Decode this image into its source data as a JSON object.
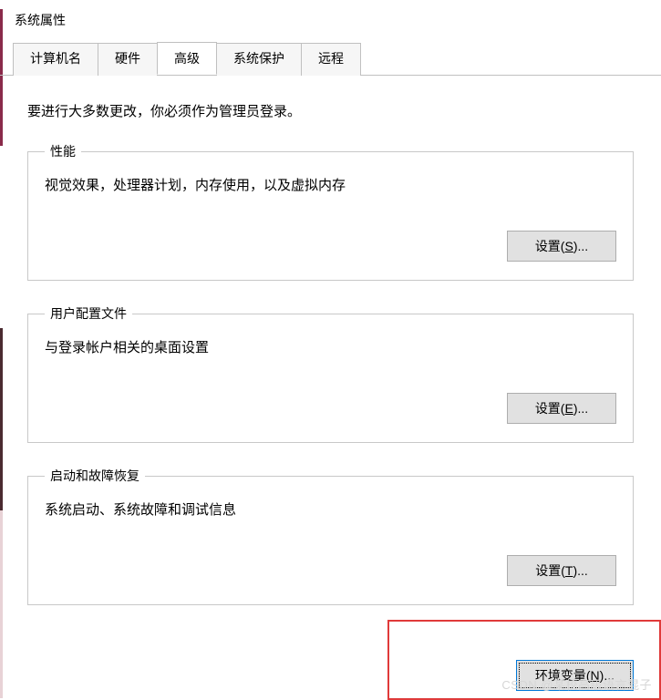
{
  "window": {
    "title": "系统属性"
  },
  "tabs": [
    {
      "label": "计算机名"
    },
    {
      "label": "硬件"
    },
    {
      "label": "高级"
    },
    {
      "label": "系统保护"
    },
    {
      "label": "远程"
    }
  ],
  "intro": "要进行大多数更改，你必须作为管理员登录。",
  "groups": {
    "performance": {
      "legend": "性能",
      "desc": "视觉效果，处理器计划，内存使用，以及虚拟内存",
      "button_prefix": "设置(",
      "button_hotkey": "S",
      "button_suffix": ")..."
    },
    "profiles": {
      "legend": "用户配置文件",
      "desc": "与登录帐户相关的桌面设置",
      "button_prefix": "设置(",
      "button_hotkey": "E",
      "button_suffix": ")..."
    },
    "recovery": {
      "legend": "启动和故障恢复",
      "desc": "系统启动、系统故障和调试信息",
      "button_prefix": "设置(",
      "button_hotkey": "T",
      "button_suffix": ")..."
    }
  },
  "env_button": {
    "prefix": "环境变量(",
    "hotkey": "N",
    "suffix": ")..."
  },
  "watermark": "CSDN @某校高级语言混子"
}
